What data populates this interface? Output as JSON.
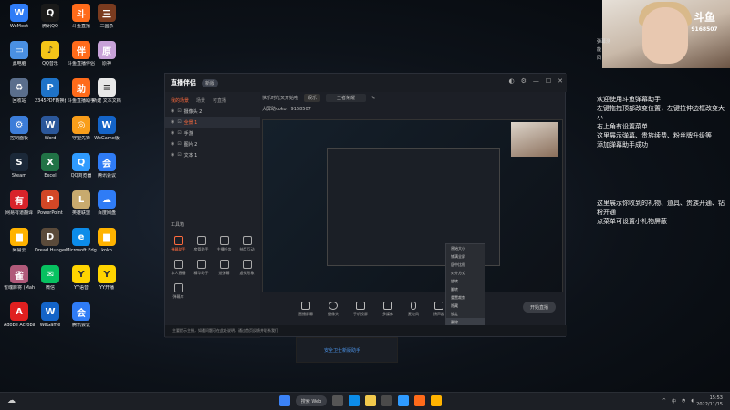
{
  "desktop_icons": [
    {
      "label": "WeMeet",
      "color": "#2f7cf6",
      "glyph": "W"
    },
    {
      "label": "腾讯QQ",
      "color": "#1a1a1a",
      "glyph": "Q"
    },
    {
      "label": "斗鱼直播",
      "color": "#ff6b1a",
      "glyph": "斗"
    },
    {
      "label": "三国杀",
      "color": "#7a3b1f",
      "glyph": "三"
    },
    {
      "label": "此电脑",
      "color": "#4a90e2",
      "glyph": "▭"
    },
    {
      "label": "QQ音乐",
      "color": "#f5c518",
      "glyph": "♪"
    },
    {
      "label": "斗鱼直播伴侣",
      "color": "#ff6b1a",
      "glyph": "伴"
    },
    {
      "label": "原神",
      "color": "#c8a2d8",
      "glyph": "原"
    },
    {
      "label": "回收站",
      "color": "#5a6e8c",
      "glyph": "♻"
    },
    {
      "label": "2345PDF转换器",
      "color": "#1e73c8",
      "glyph": "P"
    },
    {
      "label": "斗鱼直播助手",
      "color": "#ff6b1a",
      "glyph": "助"
    },
    {
      "label": "新建 文本文档",
      "color": "#e8e8e8",
      "glyph": "≡"
    },
    {
      "label": "控制面板",
      "color": "#3c7dd9",
      "glyph": "⚙"
    },
    {
      "label": "Word",
      "color": "#2b579a",
      "glyph": "W"
    },
    {
      "label": "守望先锋",
      "color": "#f99e1a",
      "glyph": "◎"
    },
    {
      "label": "WeGame版",
      "color": "#1464c8",
      "glyph": "W"
    },
    {
      "label": "Steam",
      "color": "#1b2838",
      "glyph": "S"
    },
    {
      "label": "Excel",
      "color": "#217346",
      "glyph": "X"
    },
    {
      "label": "QQ浏览器",
      "color": "#2f9bff",
      "glyph": "Q"
    },
    {
      "label": "腾讯会议",
      "color": "#2f7cf6",
      "glyph": "会"
    },
    {
      "label": "网易有道翻译",
      "color": "#d8232a",
      "glyph": "有"
    },
    {
      "label": "PowerPoint",
      "color": "#d24726",
      "glyph": "P"
    },
    {
      "label": "英雄联盟",
      "color": "#c8aa6e",
      "glyph": "L"
    },
    {
      "label": "百度网盘",
      "color": "#2f7cf6",
      "glyph": "☁"
    },
    {
      "label": "网易云",
      "color": "#ffb300",
      "glyph": "▆"
    },
    {
      "label": "Dread Hunger",
      "color": "#5a4a3a",
      "glyph": "D"
    },
    {
      "label": "Microsoft Edge",
      "color": "#0c8ce9",
      "glyph": "e"
    },
    {
      "label": "koko",
      "color": "#ffb300",
      "glyph": "▆"
    },
    {
      "label": "雀魂麻将 (Mahjong...",
      "color": "#b05a7a",
      "glyph": "雀"
    },
    {
      "label": "微信",
      "color": "#07c160",
      "glyph": "✉"
    },
    {
      "label": "YY语音",
      "color": "#ffd400",
      "glyph": "Y"
    },
    {
      "label": "YY开播",
      "color": "#ffd400",
      "glyph": "Y"
    },
    {
      "label": "Adobe Acrobat DC",
      "color": "#e02020",
      "glyph": "A"
    },
    {
      "label": "WeGame",
      "color": "#1464c8",
      "glyph": "W"
    },
    {
      "label": "腾讯会议",
      "color": "#2f7cf6",
      "glyph": "会"
    }
  ],
  "app": {
    "logo": "直播伴侣",
    "version": "新版",
    "tabs": [
      "我的场景",
      "场景",
      "可直播"
    ],
    "scenes": [
      "摄像头 2",
      "全景 1",
      "手游",
      "图片 2",
      "文本 1"
    ],
    "tools_header": "工具箱",
    "tools": [
      "弹幕助手",
      "房管助手",
      "主播任务",
      "抽奖互动",
      "本人直播",
      "精华助手",
      "送弹幕",
      "虚拟形象",
      "弹幕库"
    ],
    "room_title": "快乐时光又开始啦",
    "room_tag": "娱乐",
    "room_category": "王者荣耀",
    "room_id": "大屏助koko：9168507",
    "context_menu": [
      "原始大小",
      "铺满全屏",
      "居中比例",
      "对齐方式",
      "旋转",
      "翻转",
      "重置裁剪",
      "隐藏",
      "锁定",
      "删除"
    ],
    "bottom_buttons": [
      "直播屏幕",
      "摄像头",
      "手机投屏",
      "多媒体",
      "麦克风",
      "扬声器"
    ],
    "start_button": "开始直播",
    "notice": "主要提示主播，如遇问题可在此处说明，通过首页反馈并联系我们"
  },
  "under_window_link": "安全卫士新版助手",
  "chat": {
    "left_lines": [
      "弹幕测",
      "能",
      "同"
    ],
    "block1": "欢迎使用斗鱼弹幕助手\n左键拖拽顶部改变位置，左键拉伸边框改变大小\n右上角有设置菜单\n这里展示弹幕、贵族续费、粉丝牌升级等\n添加弹幕助手成功",
    "block2": "这里展示你收到的礼物、道具、贵族开通、钻粉开通\n点菜单可设置小礼物屏蔽"
  },
  "streamer_cam": {
    "logo": "斗鱼",
    "room": "9168507"
  },
  "taskbar": {
    "search": "搜索 Web",
    "tray_lang": "中",
    "time": "15:53",
    "date": "2022/11/15"
  }
}
